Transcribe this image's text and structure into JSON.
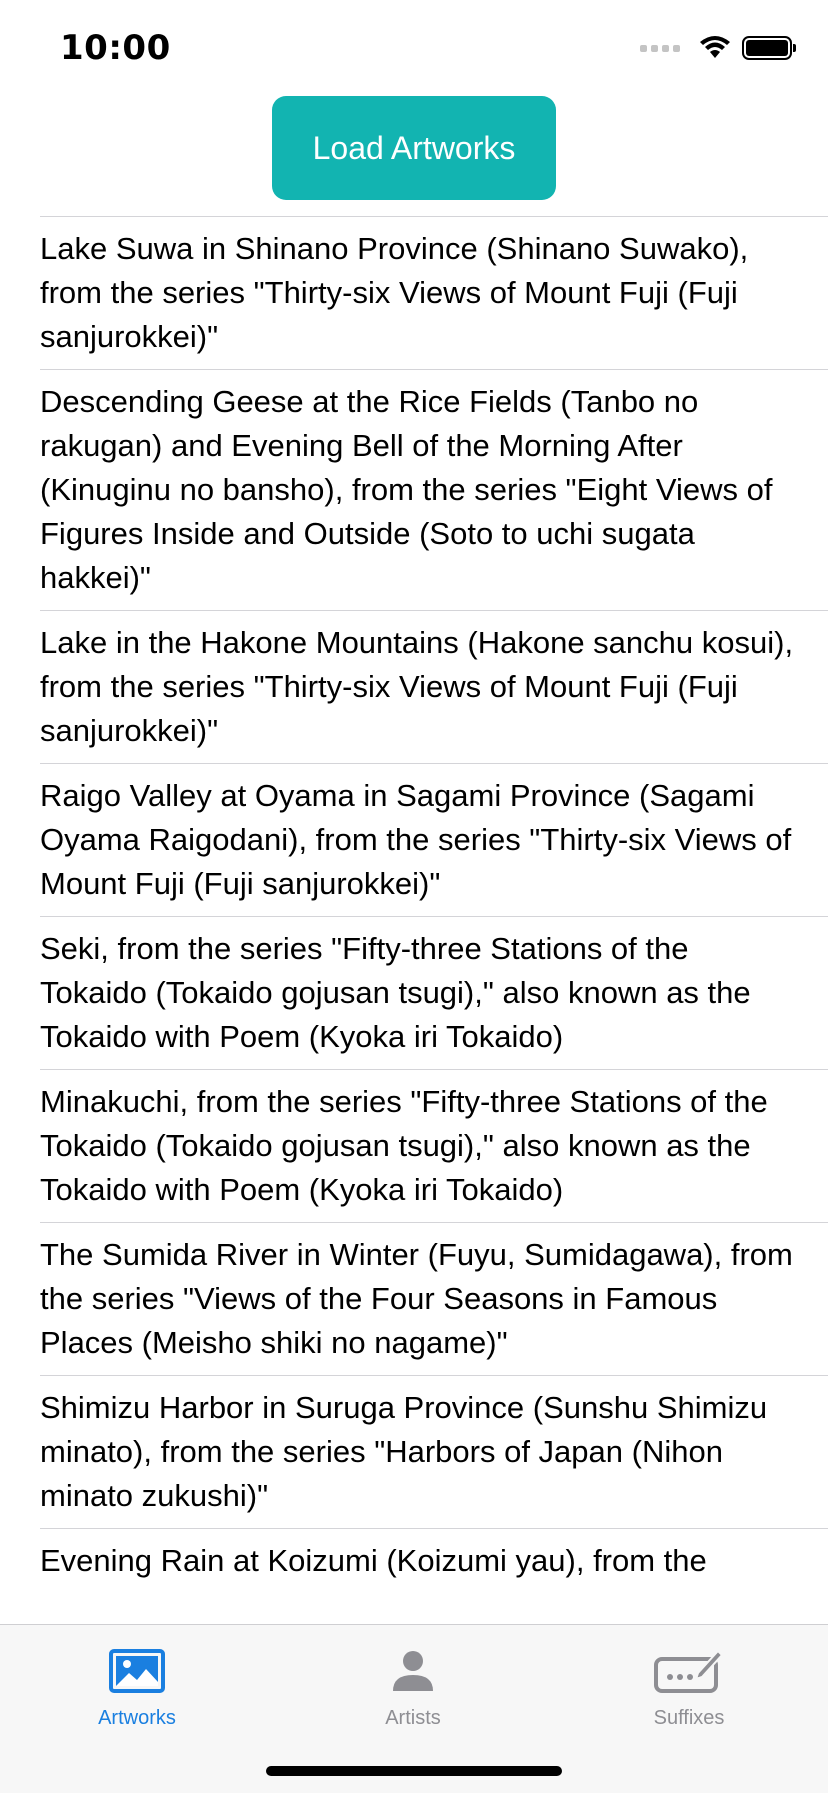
{
  "status_bar": {
    "time": "10:00"
  },
  "load_button_label": "Load Artworks",
  "artworks": [
    "Lake Suwa in Shinano Province (Shinano Suwako), from the series \"Thirty-six Views of Mount Fuji (Fuji sanjurokkei)\"",
    "Descending Geese at the Rice Fields (Tanbo no rakugan) and Evening Bell of the Morning After (Kinuginu no bansho), from the series \"Eight Views of Figures Inside and Outside (Soto to uchi sugata hakkei)\"",
    "Lake in the Hakone Mountains (Hakone sanchu kosui), from the series \"Thirty-six Views of Mount Fuji (Fuji sanjurokkei)\"",
    "Raigo Valley at Oyama in Sagami Province (Sagami Oyama Raigodani), from the series \"Thirty-six Views of Mount Fuji (Fuji sanjurokkei)\"",
    "Seki, from the series \"Fifty-three Stations of the Tokaido (Tokaido gojusan tsugi),\" also known as the Tokaido with Poem (Kyoka iri Tokaido)",
    "Minakuchi, from the series \"Fifty-three Stations of the Tokaido (Tokaido gojusan tsugi),\" also known as the Tokaido with Poem (Kyoka iri Tokaido)",
    "The Sumida River in Winter (Fuyu, Sumidagawa), from the series \"Views of the Four Seasons in Famous Places (Meisho shiki no nagame)\"",
    "Shimizu Harbor in Suruga Province (Sunshu Shimizu minato), from the series \"Harbors of Japan (Nihon minato zukushi)\"",
    "Evening Rain at Koizumi (Koizumi yau), from the"
  ],
  "tabs": [
    {
      "label": "Artworks",
      "icon": "photo-icon",
      "active": true
    },
    {
      "label": "Artists",
      "icon": "person-icon",
      "active": false
    },
    {
      "label": "Suffixes",
      "icon": "signature-icon",
      "active": false
    }
  ],
  "colors": {
    "accent": "#12b4b1",
    "tab_active": "#1a7fe0",
    "tab_inactive": "#8e8e93"
  }
}
